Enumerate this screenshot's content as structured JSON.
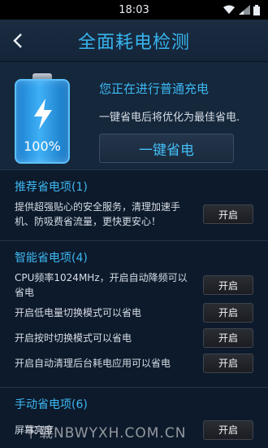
{
  "status_bar": {
    "time": "18:03"
  },
  "header": {
    "title": "全面耗电检测"
  },
  "battery": {
    "percent_label": "100%"
  },
  "hero": {
    "status": "您正在进行普通充电",
    "description": "一键省电后将优化为最佳省电...",
    "button_label": "一键省电"
  },
  "sections": [
    {
      "title": "推荐省电项(1)",
      "items": [
        {
          "text": "提供超强贴心的安全服务，清理加速手机、防吸费省流量，更快更安心！",
          "button": "开启"
        }
      ]
    },
    {
      "title": "智能省电项(4)",
      "items": [
        {
          "text": "CPU频率1024MHz，开启自动降频可以省电",
          "button": "开启"
        },
        {
          "text": "开启低电量切换模式可以省电",
          "button": "开启"
        },
        {
          "text": "开启按时切换模式可以省电",
          "button": "开启"
        },
        {
          "text": "开启自动清理后台耗电应用可以省电",
          "button": "开启"
        }
      ]
    },
    {
      "title": "手动省电项(6)",
      "items": [
        {
          "text": "屏幕亮度",
          "button": "开启"
        }
      ]
    }
  ],
  "watermark": "下载NBWYXH.COM.CN",
  "colors": {
    "accent": "#37b4ee",
    "background": "#0d1a2b"
  }
}
